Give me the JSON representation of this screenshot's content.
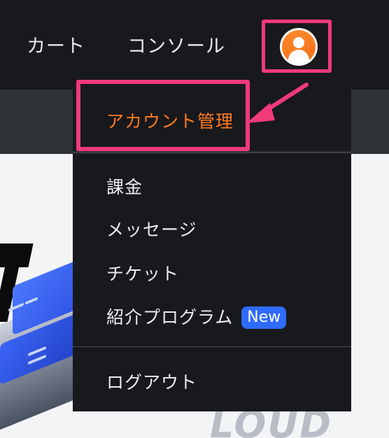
{
  "nav": {
    "cart_label": "カート",
    "console_label": "コンソール",
    "avatar_icon": "user-avatar-icon"
  },
  "dropdown": {
    "account_label": "アカウント管理",
    "items": [
      {
        "label": "課金"
      },
      {
        "label": "メッセージ"
      },
      {
        "label": "チケット"
      },
      {
        "label": "紹介プログラム",
        "badge": "New"
      }
    ],
    "logout_label": "ログアウト"
  },
  "hero": {
    "word": "LOUD"
  },
  "colors": {
    "topbar_bg": "#18191d",
    "accent_orange": "#ff7a20",
    "highlight_pink": "#f03a7a",
    "badge_blue": "#2f6bff"
  }
}
